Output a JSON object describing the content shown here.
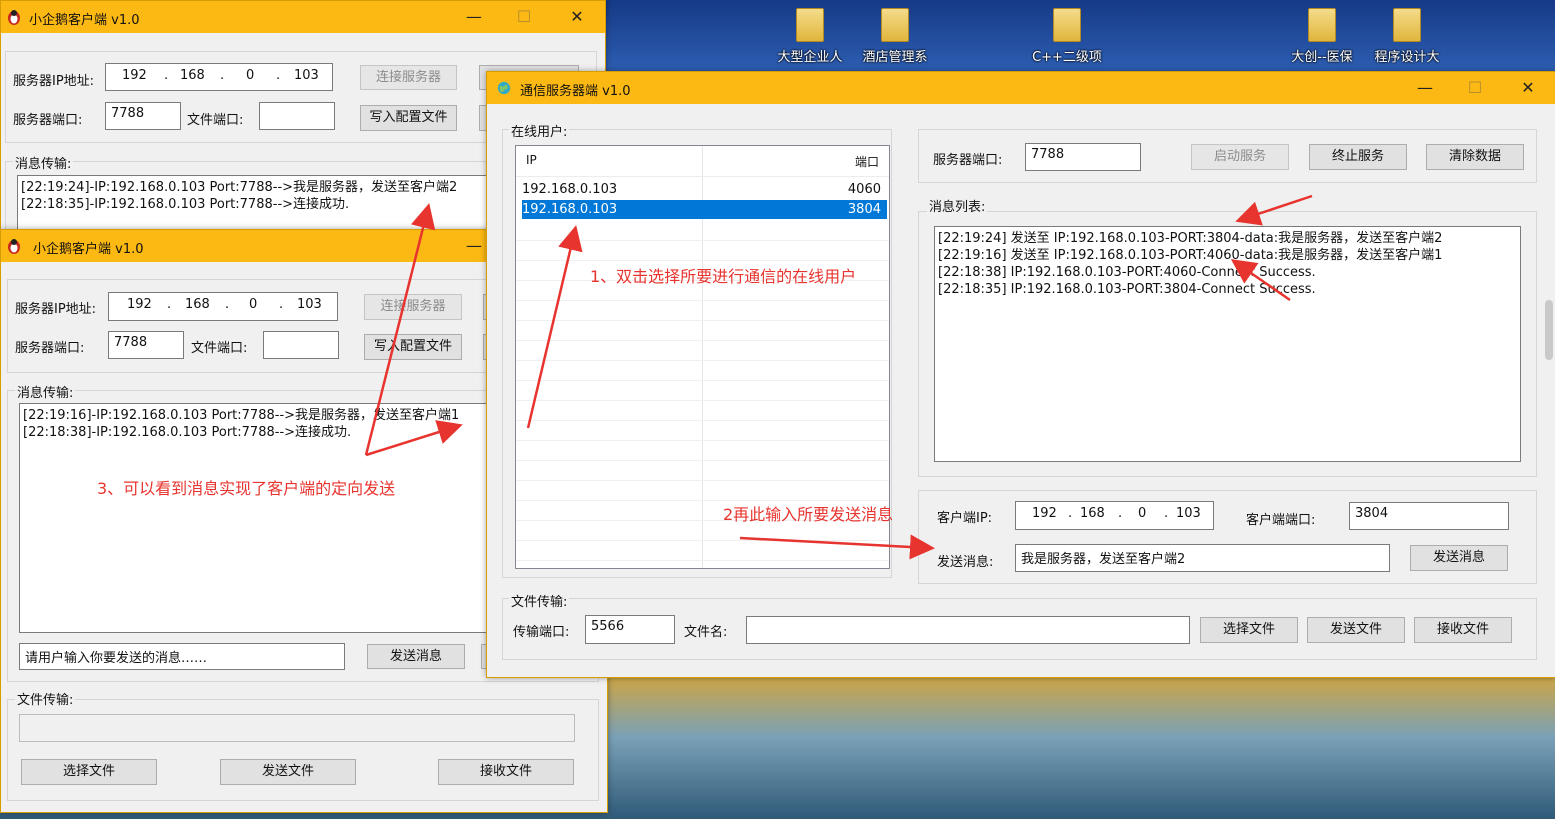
{
  "desktop": {
    "icons": [
      "大型企业人",
      "酒店管理系",
      "C++二级项",
      "大创--医保",
      "程序设计大"
    ]
  },
  "client1": {
    "title": "小企鹅客户端 v1.0",
    "ip_label": "服务器IP地址:",
    "ip": [
      "192",
      "168",
      "0",
      "103"
    ],
    "port_label": "服务器端口:",
    "port": "7788",
    "file_port_label": "文件端口:",
    "file_port": "",
    "connect_btn": "连接服务器",
    "write_config_btn": "写入配置文件",
    "msg_label": "消息传输:",
    "messages": [
      "[22:19:24]-IP:192.168.0.103 Port:7788-->我是服务器，发送至客户端2",
      "[22:18:35]-IP:192.168.0.103 Port:7788-->连接成功."
    ]
  },
  "client2": {
    "title": "小企鹅客户端 v1.0",
    "ip_label": "服务器IP地址:",
    "ip": [
      "192",
      "168",
      "0",
      "103"
    ],
    "port_label": "服务器端口:",
    "port": "7788",
    "file_port_label": "文件端口:",
    "file_port": "",
    "connect_btn": "连接服务器",
    "write_config_btn": "写入配置文件",
    "msg_label": "消息传输:",
    "messages": [
      "[22:19:16]-IP:192.168.0.103 Port:7788-->我是服务器，发送至客户端1",
      "[22:18:38]-IP:192.168.0.103 Port:7788-->连接成功."
    ],
    "input_value": "请用户输入你要发送的消息……",
    "send_btn": "发送消息",
    "file_label": "文件传输:",
    "file_path": "",
    "choose_btn": "选择文件",
    "send_file_btn": "发送文件",
    "recv_btn": "接收文件"
  },
  "server": {
    "title": "通信服务器端 v1.0",
    "online_label": "在线用户:",
    "col_ip": "IP",
    "col_port": "端口",
    "users": [
      {
        "ip": "192.168.0.103",
        "port": "4060",
        "selected": false
      },
      {
        "ip": "192.168.0.103",
        "port": "3804",
        "selected": true
      }
    ],
    "port_label": "服务器端口:",
    "port": "7788",
    "start_btn": "启动服务",
    "stop_btn": "终止服务",
    "clear_btn": "清除数据",
    "msglist_label": "消息列表:",
    "messages": [
      "[22:19:24] 发送至 IP:192.168.0.103-PORT:3804-data:我是服务器，发送至客户端2",
      "[22:19:16] 发送至 IP:192.168.0.103-PORT:4060-data:我是服务器，发送至客户端1",
      "[22:18:38] IP:192.168.0.103-PORT:4060-Connect Success.",
      "[22:18:35] IP:192.168.0.103-PORT:3804-Connect Success."
    ],
    "client_ip_label": "客户端IP:",
    "client_ip": [
      "192",
      "168",
      "0",
      "103"
    ],
    "client_port_label": "客户端端口:",
    "client_port": "3804",
    "send_label": "发送消息:",
    "send_value": "我是服务器，发送至客户端2",
    "send_btn": "发送消息",
    "file_group_label": "文件传输:",
    "trans_port_label": "传输端口:",
    "trans_port": "5566",
    "file_name_label": "文件名:",
    "file_name": "",
    "choose_btn": "选择文件",
    "send_file_btn": "发送文件",
    "recv_btn": "接收文件"
  },
  "annotations": {
    "note1": "1、双击选择所要进行通信的在线用户",
    "note2": "2再此输入所要发送消息",
    "note3": "3、可以看到消息实现了客户端的定向发送",
    "color": "#e8342f"
  },
  "colors": {
    "titlebar": "#fdb913",
    "selection": "#0078d7"
  }
}
